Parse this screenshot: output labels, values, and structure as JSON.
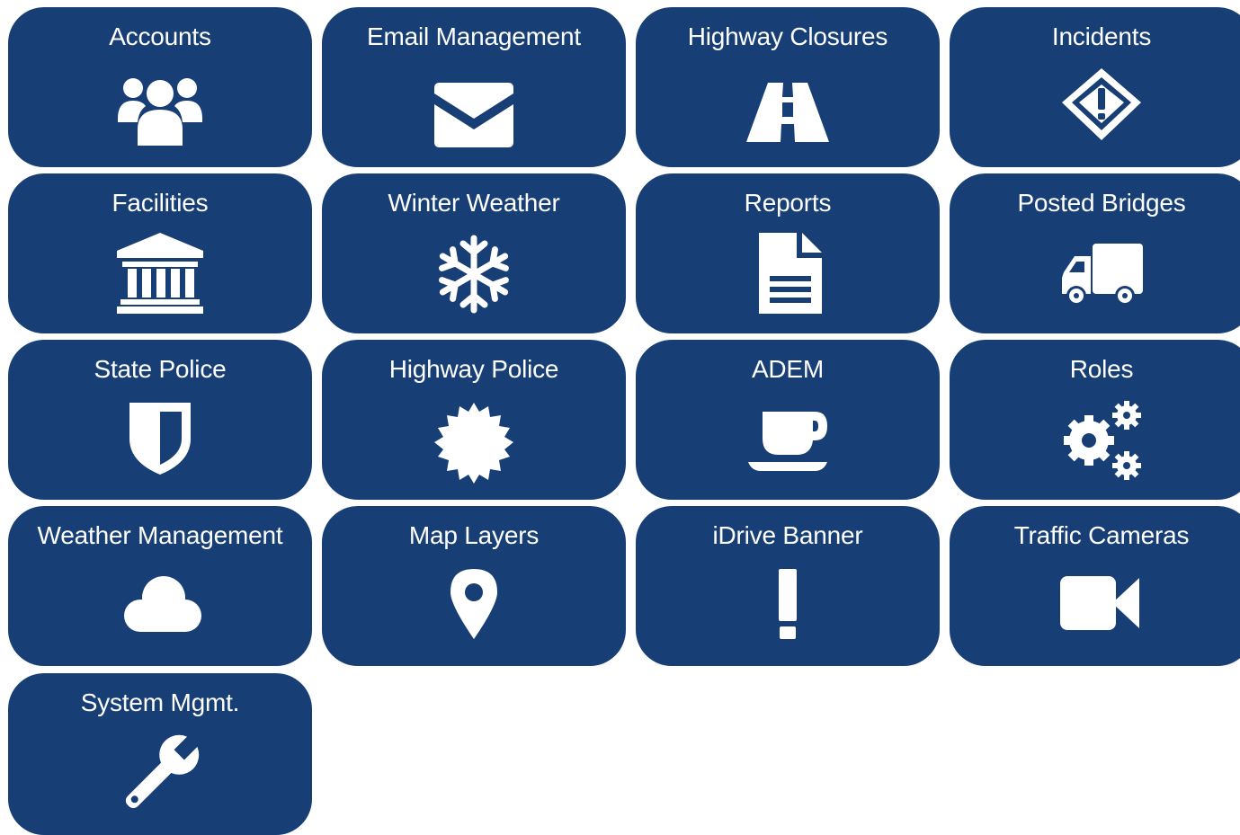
{
  "colors": {
    "tile_background": "#173f75",
    "tile_foreground": "#ffffff",
    "page_background": "#ffffff"
  },
  "tiles": [
    {
      "label": "Accounts",
      "icon": "users-icon"
    },
    {
      "label": "Email Management",
      "icon": "envelope-icon"
    },
    {
      "label": "Highway Closures",
      "icon": "road-icon"
    },
    {
      "label": "Incidents",
      "icon": "warning-diamond-icon"
    },
    {
      "label": "Facilities",
      "icon": "building-columns-icon"
    },
    {
      "label": "Winter Weather",
      "icon": "snowflake-icon"
    },
    {
      "label": "Reports",
      "icon": "document-icon"
    },
    {
      "label": "Posted Bridges",
      "icon": "truck-icon"
    },
    {
      "label": "State Police",
      "icon": "shield-icon"
    },
    {
      "label": "Highway Police",
      "icon": "badge-icon"
    },
    {
      "label": "ADEM",
      "icon": "coffee-cup-icon"
    },
    {
      "label": "Roles",
      "icon": "gears-icon"
    },
    {
      "label": "Weather Management",
      "icon": "cloud-icon"
    },
    {
      "label": "Map Layers",
      "icon": "map-marker-icon"
    },
    {
      "label": "iDrive Banner",
      "icon": "exclamation-icon"
    },
    {
      "label": "Traffic Cameras",
      "icon": "video-camera-icon"
    },
    {
      "label": "System Mgmt.",
      "icon": "wrench-icon"
    }
  ]
}
